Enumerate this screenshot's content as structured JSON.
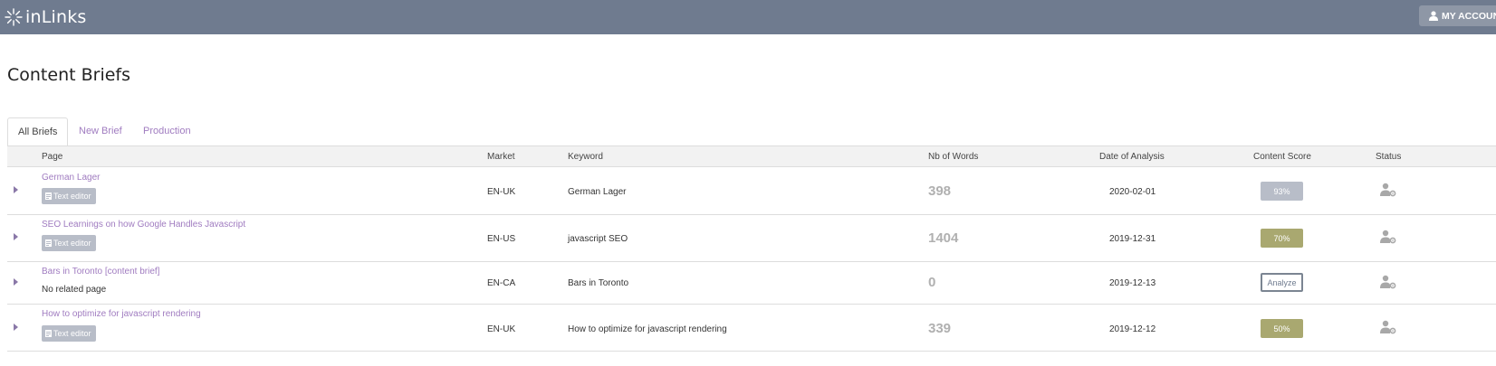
{
  "app": {
    "name": "inLinks",
    "account_button": "MY ACCOUNT",
    "brand_color": "#6f7b8f",
    "link_color": "#a07cc0"
  },
  "page": {
    "title": "Content Briefs"
  },
  "tabs": [
    {
      "label": "All Briefs",
      "active": true
    },
    {
      "label": "New Brief",
      "active": false
    },
    {
      "label": "Production",
      "active": false
    }
  ],
  "table": {
    "headers": {
      "page": "Page",
      "market": "Market",
      "keyword": "Keyword",
      "words": "Nb of Words",
      "date": "Date of Analysis",
      "score": "Content Score",
      "status": "Status"
    },
    "rows": [
      {
        "page": "German Lager",
        "sub_type": "button",
        "sub_label": "Text editor",
        "market": "EN-UK",
        "keyword": "German Lager",
        "words": "398",
        "date": "2020-02-01",
        "score": "93%",
        "score_color": "#b8bdc8",
        "score_style": "filled",
        "status_icon": "user-gear-icon"
      },
      {
        "page": "SEO Learnings on how Google Handles Javascript",
        "sub_type": "button",
        "sub_label": "Text editor",
        "market": "EN-US",
        "keyword": "javascript SEO",
        "words": "1404",
        "date": "2019-12-31",
        "score": "70%",
        "score_color": "#a9a870",
        "score_style": "filled",
        "status_icon": "user-gear-icon"
      },
      {
        "page": "Bars in Toronto [content brief]",
        "sub_type": "text",
        "sub_label": "No related page",
        "market": "EN-CA",
        "keyword": "Bars in Toronto",
        "words": "0",
        "date": "2019-12-13",
        "score": "Analyze",
        "score_color": "#7b8592",
        "score_style": "outline",
        "status_icon": "user-gear-icon"
      },
      {
        "page": "How to optimize for javascript rendering",
        "sub_type": "button",
        "sub_label": "Text editor",
        "market": "EN-UK",
        "keyword": "How to optimize for javascript rendering",
        "words": "339",
        "date": "2019-12-12",
        "score": "50%",
        "score_color": "#a9a870",
        "score_style": "filled",
        "status_icon": "user-gear-icon"
      }
    ]
  }
}
